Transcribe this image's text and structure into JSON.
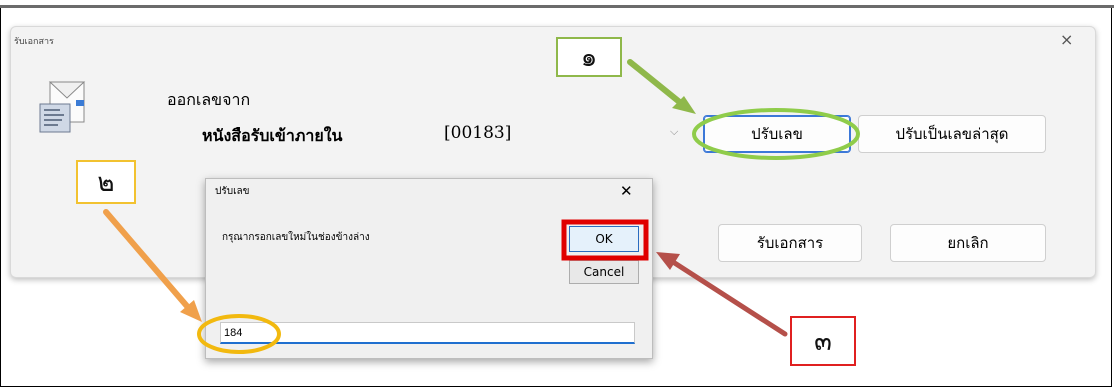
{
  "main_window": {
    "title": "รับเอกสาร",
    "section_label": "ออกเลขจาก",
    "source_name": "หนังสือรับเข้าภายใน",
    "number_value": "[00183]",
    "buttons": {
      "adjust_number": "ปรับเลข",
      "adjust_latest": "ปรับเป็นเลขล่าสุด",
      "receive": "รับเอกสาร",
      "cancel": "ยกเลิก"
    },
    "close_symbol": "×"
  },
  "dialog": {
    "title": "ปรับเลข",
    "message": "กรุณากรอกเลขใหม่ในช่องข้างล่าง",
    "ok_label": "OK",
    "cancel_label": "Cancel",
    "input_value": "184",
    "close_symbol": "✕"
  },
  "annotations": {
    "step1": "๑",
    "step2": "๒",
    "step3": "๓",
    "colors": {
      "step1_arrow": "#8fb84a",
      "step2_arrow": "#f0a04b",
      "step3_arrow": "#b5504a",
      "box1": "#8fb84a",
      "box2": "#f2c230",
      "box3": "#e02020",
      "ok_highlight": "#e00000",
      "ellipse_green": "#8fcc4a",
      "ellipse_yellow": "#f2b90f"
    }
  }
}
